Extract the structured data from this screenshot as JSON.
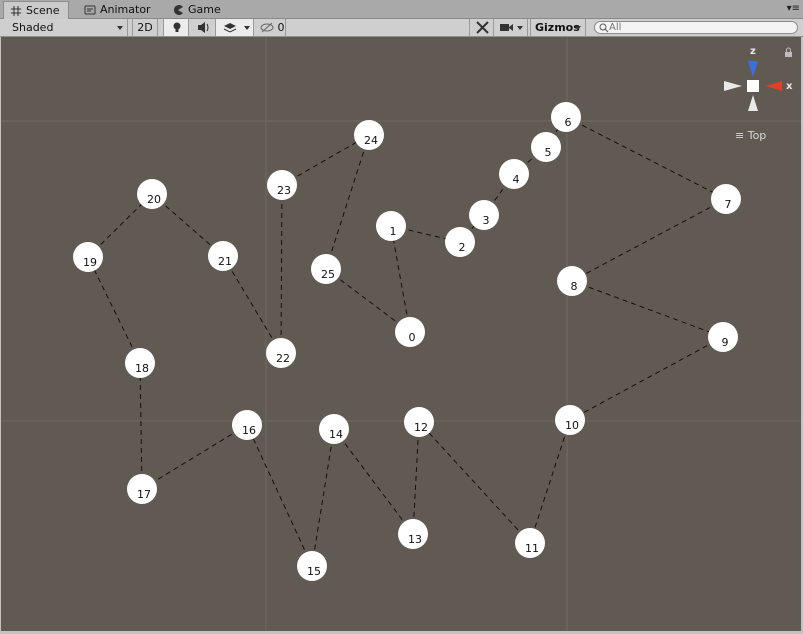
{
  "tabs": [
    {
      "label": "Scene",
      "icon": "grid-icon",
      "active": true
    },
    {
      "label": "Animator",
      "icon": "animator-icon",
      "active": false
    },
    {
      "label": "Game",
      "icon": "pacman-icon",
      "active": false
    }
  ],
  "toolbar": {
    "shading_mode": "Shaded",
    "mode_2d": "2D",
    "hidden_count": "0",
    "gizmos": "Gizmos",
    "search_placeholder": "All"
  },
  "gizmo": {
    "z": "z",
    "x": "x",
    "view_label": "Top"
  },
  "colors": {
    "scene_bg": "#615a53",
    "grid": "#6f6961",
    "node": "#ffffff",
    "edge": "#111111",
    "x_axis": "#e0402a",
    "z_axis": "#3b6fe0"
  },
  "nodes": [
    "0",
    "1",
    "2",
    "3",
    "4",
    "5",
    "6",
    "7",
    "8",
    "9",
    "10",
    "11",
    "12",
    "13",
    "14",
    "15",
    "16",
    "17",
    "18",
    "19",
    "20",
    "21",
    "22",
    "23",
    "24",
    "25"
  ],
  "edges": [
    [
      0,
      1
    ],
    [
      1,
      2
    ],
    [
      2,
      3
    ],
    [
      3,
      4
    ],
    [
      4,
      5
    ],
    [
      5,
      6
    ],
    [
      6,
      7
    ],
    [
      7,
      8
    ],
    [
      8,
      9
    ],
    [
      9,
      10
    ],
    [
      10,
      11
    ],
    [
      11,
      12
    ],
    [
      12,
      13
    ],
    [
      13,
      14
    ],
    [
      14,
      15
    ],
    [
      15,
      16
    ],
    [
      16,
      17
    ],
    [
      17,
      18
    ],
    [
      18,
      19
    ],
    [
      19,
      20
    ],
    [
      20,
      21
    ],
    [
      21,
      22
    ],
    [
      22,
      23
    ],
    [
      23,
      24
    ],
    [
      24,
      25
    ],
    [
      25,
      0
    ]
  ]
}
